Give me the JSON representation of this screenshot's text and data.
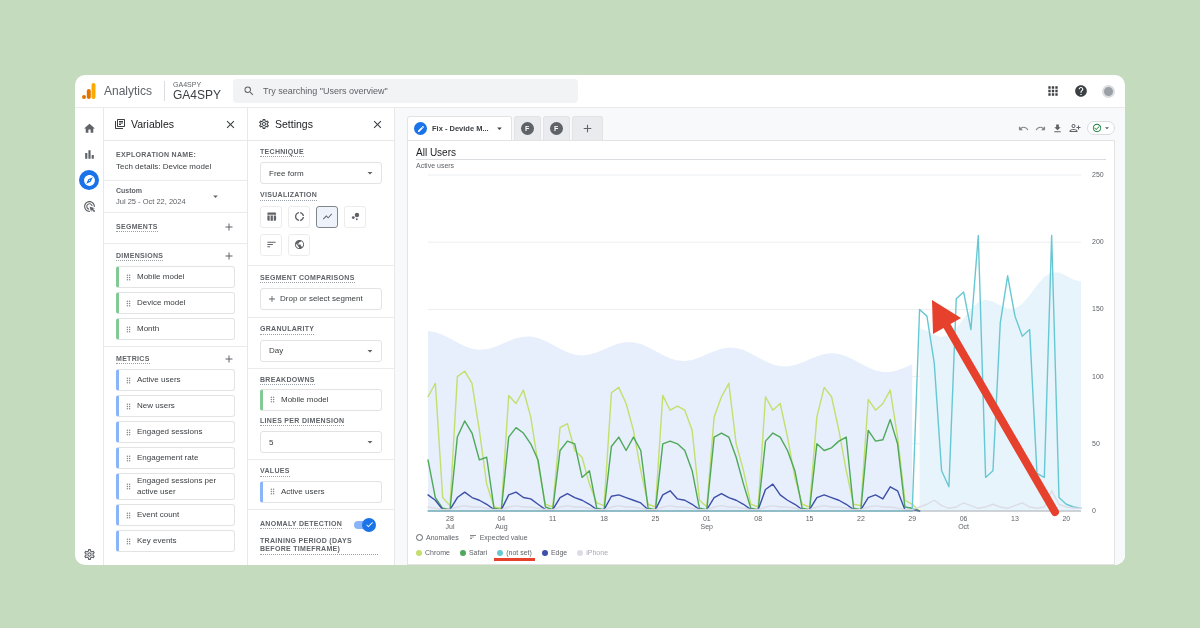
{
  "topbar": {
    "product": "Analytics",
    "account": "GA4SPY",
    "property": "GA4SPY",
    "search": {
      "placeholder": "Try searching \"Users overview\""
    }
  },
  "nav": [
    {
      "kind": "home",
      "selected": false
    },
    {
      "kind": "reports",
      "selected": false
    },
    {
      "kind": "explore",
      "selected": true
    },
    {
      "kind": "advertising",
      "selected": false
    }
  ],
  "nav_footer": {
    "kind": "admin"
  },
  "variables": {
    "title": "Variables",
    "exploration_name_label": "EXPLORATION NAME:",
    "exploration_name": "Tech details: Device model",
    "date_range": {
      "label": "Custom",
      "value": "Jul 25 - Oct 22, 2024"
    },
    "segments": {
      "title": "SEGMENTS"
    },
    "dimensions": {
      "title": "DIMENSIONS",
      "items": [
        "Mobile model",
        "Device model",
        "Month"
      ]
    },
    "metrics": {
      "title": "METRICS",
      "items": [
        "Active users",
        "New users",
        "Engaged sessions",
        "Engagement rate",
        "Engaged sessions per active user",
        "Event count",
        "Key events"
      ]
    }
  },
  "settings": {
    "title": "Settings",
    "technique": {
      "label": "TECHNIQUE",
      "value": "Free form"
    },
    "visualization": {
      "label": "VISUALIZATION",
      "options": [
        {
          "kind": "table",
          "selected": false
        },
        {
          "kind": "donut",
          "selected": false
        },
        {
          "kind": "line",
          "selected": true
        },
        {
          "kind": "scatter",
          "selected": false
        },
        {
          "kind": "bar",
          "selected": false
        },
        {
          "kind": "geo",
          "selected": false
        }
      ]
    },
    "segment_comparisons": {
      "label": "SEGMENT COMPARISONS",
      "drop_zone": "Drop or select segment"
    },
    "granularity": {
      "label": "GRANULARITY",
      "value": "Day"
    },
    "breakdowns": {
      "label": "BREAKDOWNS",
      "items": [
        "Mobile model"
      ]
    },
    "lines_per_dimension": {
      "label": "LINES PER DIMENSION",
      "value": "5"
    },
    "values": {
      "label": "VALUES",
      "items": [
        "Active users"
      ]
    },
    "anomaly_detection": {
      "label": "ANOMALY DETECTION",
      "on": true
    },
    "training_period": {
      "label": "TRAINING PERIOD (DAYS BEFORE TIMEFRAME)"
    }
  },
  "tabs": [
    {
      "kind": "named",
      "label": "Fix - Devide M...",
      "selected": true
    },
    {
      "kind": "initial",
      "label": "F",
      "selected": false
    },
    {
      "kind": "initial",
      "label": "F",
      "selected": false
    }
  ],
  "chart_card": {
    "title": "All Users",
    "subtitle": "Active users",
    "anomaly_legend": [
      {
        "kind": "anomaly",
        "label": "Anomalies"
      },
      {
        "kind": "expected",
        "label": "Expected value"
      }
    ],
    "legend": [
      {
        "highlighted": false,
        "muted": false
      },
      {
        "highlighted": false,
        "muted": false
      },
      {
        "highlighted": true,
        "muted": false
      },
      {
        "highlighted": false,
        "muted": false
      },
      {
        "highlighted": false,
        "muted": true
      }
    ],
    "chart_data": {
      "type": "line",
      "grid": true,
      "ylim": [
        0,
        250
      ],
      "yticks": [
        0,
        50,
        100,
        150,
        200,
        250
      ],
      "categories": [
        null,
        null,
        null,
        "28 Jul",
        null,
        null,
        null,
        null,
        null,
        null,
        "04 Aug",
        null,
        null,
        null,
        null,
        null,
        null,
        "11",
        null,
        null,
        null,
        null,
        null,
        null,
        "18",
        null,
        null,
        null,
        null,
        null,
        null,
        "25",
        null,
        null,
        null,
        null,
        null,
        null,
        "01 Sep",
        null,
        null,
        null,
        null,
        null,
        null,
        "08",
        null,
        null,
        null,
        null,
        null,
        null,
        "15",
        null,
        null,
        null,
        null,
        null,
        null,
        "22",
        null,
        null,
        null,
        null,
        null,
        null,
        "29",
        null,
        null,
        null,
        null,
        null,
        null,
        "06 Oct",
        null,
        null,
        null,
        null,
        null,
        null,
        "13",
        null,
        null,
        null,
        null,
        null,
        null,
        "20",
        null,
        null
      ],
      "series": [
        {
          "name": "Chrome",
          "color": "#c3df6e",
          "values": [
            85,
            95,
            10,
            4,
            100,
            104,
            95,
            60,
            20,
            3,
            2,
            86,
            80,
            90,
            70,
            35,
            5,
            3,
            62,
            65,
            45,
            40,
            20,
            6,
            4,
            88,
            92,
            80,
            60,
            30,
            5,
            3,
            86,
            75,
            78,
            75,
            60,
            8,
            3,
            70,
            85,
            95,
            50,
            30,
            5,
            3,
            85,
            75,
            80,
            55,
            25,
            5,
            3,
            70,
            92,
            85,
            60,
            30,
            5,
            4,
            83,
            75,
            80,
            90,
            55,
            8,
            5,
            0,
            null,
            null,
            null,
            null,
            null,
            null,
            null,
            null,
            null,
            null,
            null,
            null,
            null,
            null,
            null,
            null,
            null,
            null,
            null,
            null,
            null,
            null
          ]
        },
        {
          "name": "Safari",
          "color": "#4fa859",
          "values": [
            38,
            10,
            2,
            1,
            55,
            67,
            58,
            38,
            40,
            2,
            1,
            55,
            62,
            58,
            50,
            38,
            3,
            1,
            45,
            52,
            50,
            25,
            30,
            2,
            1,
            48,
            55,
            45,
            55,
            45,
            2,
            1,
            50,
            52,
            50,
            45,
            30,
            2,
            1,
            55,
            58,
            55,
            40,
            20,
            2,
            1,
            52,
            58,
            55,
            45,
            30,
            2,
            1,
            50,
            45,
            47,
            52,
            55,
            2,
            1,
            60,
            52,
            53,
            68,
            50,
            3,
            2,
            0,
            null,
            null,
            null,
            null,
            null,
            null,
            null,
            null,
            null,
            null,
            null,
            null,
            null,
            null,
            null,
            null,
            null,
            null,
            null,
            null,
            null,
            null
          ]
        },
        {
          "name": "(not set)",
          "color": "#67c8d3",
          "values": [
            0,
            0,
            0,
            0,
            0,
            0,
            0,
            0,
            0,
            0,
            0,
            0,
            0,
            0,
            0,
            0,
            0,
            0,
            0,
            0,
            0,
            0,
            0,
            0,
            0,
            0,
            0,
            0,
            0,
            0,
            0,
            0,
            0,
            0,
            0,
            0,
            0,
            0,
            0,
            0,
            0,
            0,
            0,
            0,
            0,
            0,
            0,
            0,
            0,
            0,
            0,
            0,
            0,
            0,
            0,
            0,
            0,
            0,
            0,
            0,
            0,
            0,
            0,
            0,
            0,
            0,
            0,
            150,
            145,
            110,
            30,
            18,
            158,
            163,
            135,
            205,
            25,
            30,
            140,
            175,
            145,
            130,
            135,
            28,
            25,
            205,
            10,
            5,
            3,
            2
          ]
        },
        {
          "name": "Edge",
          "color": "#3d4fa8",
          "values": [
            12,
            8,
            1,
            1,
            10,
            14,
            10,
            8,
            5,
            1,
            1,
            12,
            14,
            10,
            9,
            5,
            1,
            1,
            10,
            13,
            10,
            8,
            5,
            1,
            1,
            11,
            12,
            10,
            8,
            6,
            1,
            1,
            12,
            15,
            9,
            8,
            5,
            1,
            1,
            10,
            13,
            10,
            8,
            5,
            1,
            1,
            16,
            20,
            12,
            8,
            5,
            1,
            1,
            10,
            12,
            10,
            8,
            5,
            1,
            1,
            10,
            12,
            9,
            18,
            15,
            1,
            1,
            0,
            null,
            null,
            null,
            null,
            null,
            null,
            null,
            null,
            null,
            null,
            null,
            null,
            null,
            null,
            null,
            null,
            null,
            null,
            null,
            null,
            null,
            null
          ]
        },
        {
          "name": "iPhone",
          "color": "#dcdce6",
          "values": [
            3,
            2,
            1,
            1,
            3,
            4,
            3,
            3,
            2,
            1,
            1,
            3,
            4,
            3,
            3,
            2,
            1,
            1,
            3,
            4,
            3,
            3,
            2,
            1,
            1,
            3,
            4,
            3,
            3,
            2,
            1,
            1,
            3,
            4,
            3,
            3,
            2,
            1,
            1,
            3,
            4,
            3,
            3,
            2,
            1,
            1,
            3,
            4,
            3,
            3,
            2,
            1,
            1,
            3,
            4,
            3,
            3,
            2,
            1,
            1,
            3,
            4,
            3,
            3,
            2,
            1,
            1,
            3,
            5,
            8,
            4,
            2,
            3,
            6,
            4,
            2,
            3,
            5,
            3,
            2,
            4,
            6,
            3,
            2,
            3,
            15,
            5,
            3,
            2,
            2
          ]
        }
      ]
    }
  }
}
